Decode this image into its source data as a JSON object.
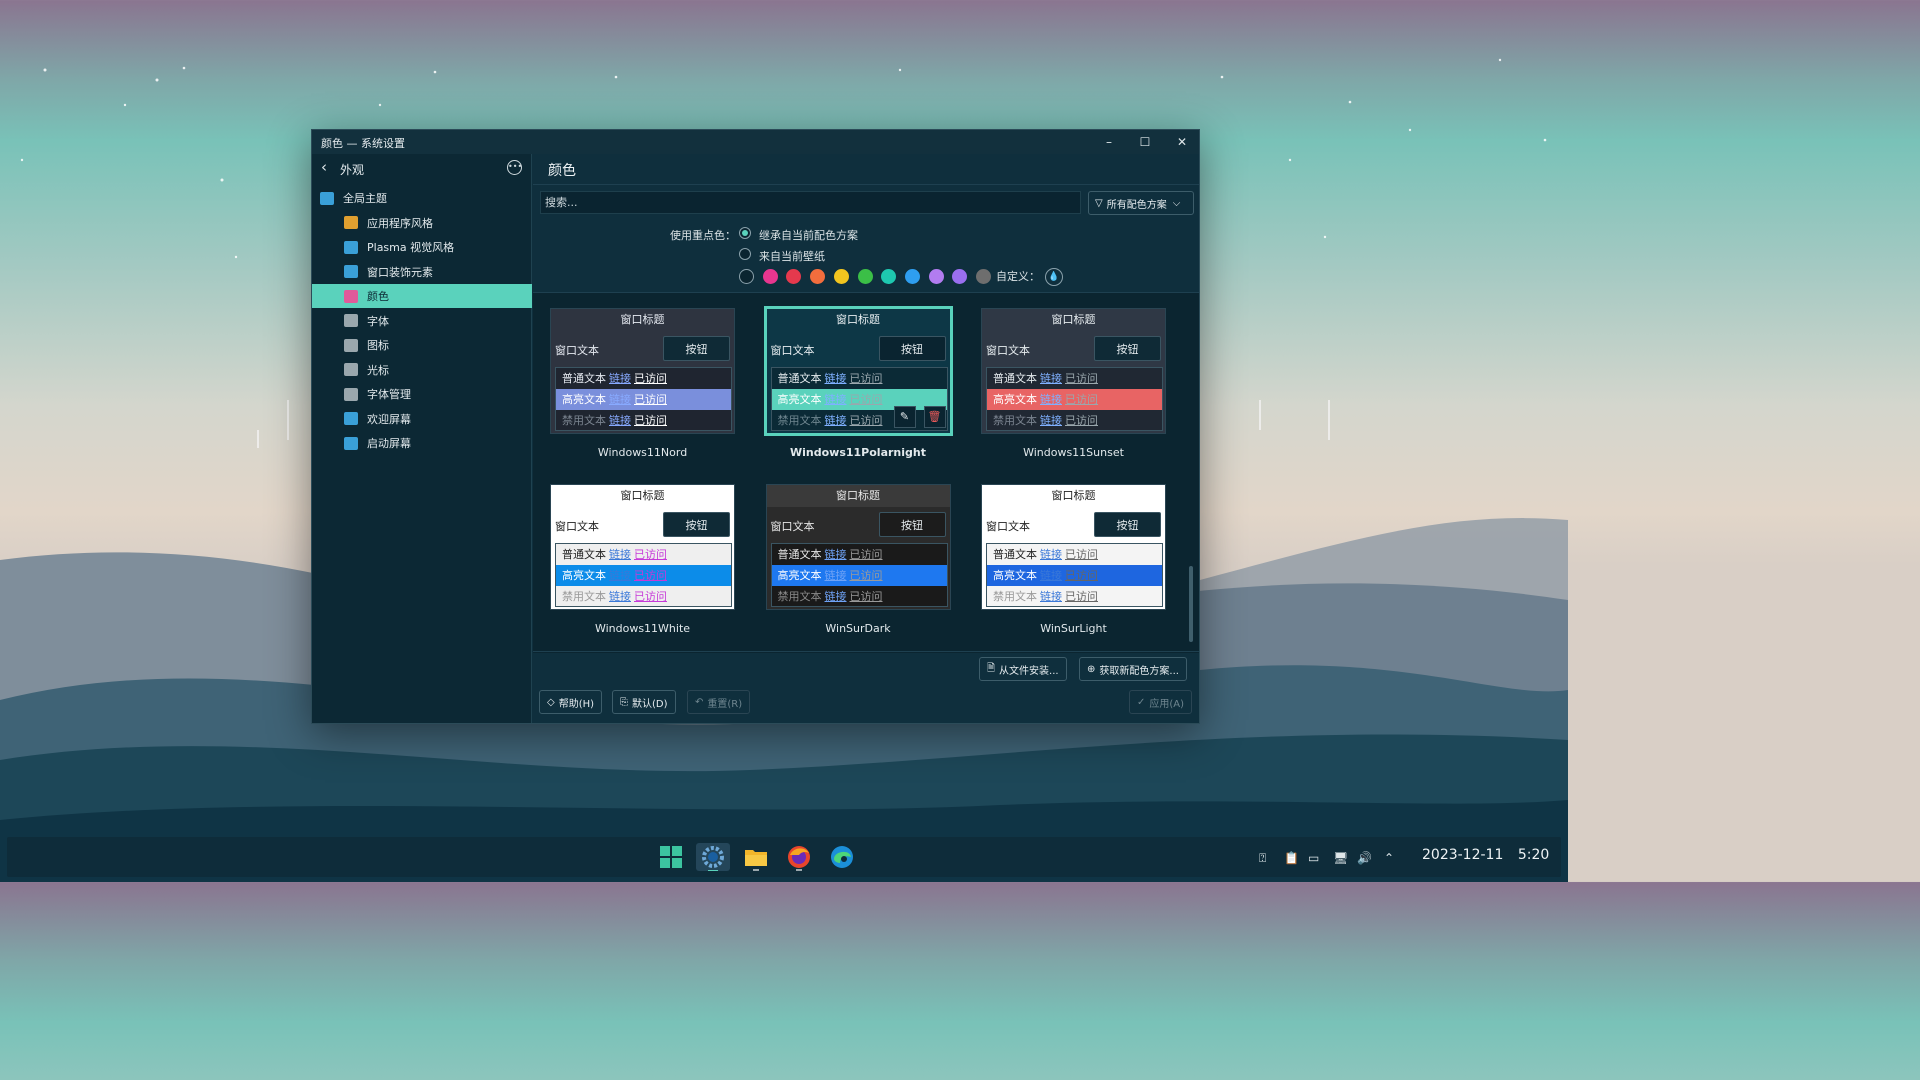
{
  "window": {
    "title": "颜色 — 系统设置",
    "minimize_label": "–",
    "maximize_label": "☐",
    "close_label": "✕"
  },
  "sidebar": {
    "back_label": "外观",
    "items": [
      {
        "label": "全局主题",
        "icon": "global-theme-icon",
        "color": "#3aa0d8"
      },
      {
        "label": "应用程序风格",
        "icon": "app-style-icon",
        "color": "#e0a030"
      },
      {
        "label": "Plasma 视觉风格",
        "icon": "plasma-style-icon",
        "color": "#3aa0d8"
      },
      {
        "label": "窗口装饰元素",
        "icon": "window-decoration-icon",
        "color": "#3aa0d8"
      },
      {
        "label": "颜色",
        "icon": "colors-icon",
        "color": "#e05a9a"
      },
      {
        "label": "字体",
        "icon": "fonts-icon",
        "color": "#9aa7ad"
      },
      {
        "label": "图标",
        "icon": "icons-icon",
        "color": "#9aa7ad"
      },
      {
        "label": "光标",
        "icon": "cursor-icon",
        "color": "#9aa7ad"
      },
      {
        "label": "字体管理",
        "icon": "font-manager-icon",
        "color": "#9aa7ad"
      },
      {
        "label": "欢迎屏幕",
        "icon": "splash-screen-icon",
        "color": "#3aa0d8"
      },
      {
        "label": "启动屏幕",
        "icon": "boot-screen-icon",
        "color": "#3aa0d8"
      }
    ],
    "active_index": 4
  },
  "content": {
    "title": "颜色",
    "search_placeholder": "搜索...",
    "filter_label": "所有配色方案",
    "accent_label": "使用重点色：",
    "radio_inherit": "继承自当前配色方案",
    "radio_wallpaper": "来自当前壁纸",
    "custom_label": "自定义：",
    "swatches": [
      "#0b2530",
      "#e8368f",
      "#e5394d",
      "#f26d3d",
      "#f2c51f",
      "#3bbf47",
      "#1ec8b0",
      "#2e9ef0",
      "#b27cf0",
      "#9a6ff0",
      "#6e6e6e"
    ]
  },
  "schemes": [
    {
      "name": "Windows11Nord",
      "title": "窗口标题",
      "window_text": "窗口文本",
      "button": "按钮",
      "normal": "普通文本",
      "highlight": "高亮文本",
      "disabled": "禁用文本",
      "link": "链接",
      "visited": "已访问"
    },
    {
      "name": "Windows11Polarnight",
      "title": "窗口标题",
      "window_text": "窗口文本",
      "button": "按钮",
      "normal": "普通文本",
      "highlight": "高亮文本",
      "disabled": "禁用文本",
      "link": "链接",
      "visited": "已访问"
    },
    {
      "name": "Windows11Sunset",
      "title": "窗口标题",
      "window_text": "窗口文本",
      "button": "按钮",
      "normal": "普通文本",
      "highlight": "高亮文本",
      "disabled": "禁用文本",
      "link": "链接",
      "visited": "已访问"
    },
    {
      "name": "Windows11White",
      "title": "窗口标题",
      "window_text": "窗口文本",
      "button": "按钮",
      "normal": "普通文本",
      "highlight": "高亮文本",
      "disabled": "禁用文本",
      "link": "链接",
      "visited": "已访问"
    },
    {
      "name": "WinSurDark",
      "title": "窗口标题",
      "window_text": "窗口文本",
      "button": "按钮",
      "normal": "普通文本",
      "highlight": "高亮文本",
      "disabled": "禁用文本",
      "link": "链接",
      "visited": "已访问"
    },
    {
      "name": "WinSurLight",
      "title": "窗口标题",
      "window_text": "窗口文本",
      "button": "按钮",
      "normal": "普通文本",
      "highlight": "高亮文本",
      "disabled": "禁用文本",
      "link": "链接",
      "visited": "已访问"
    }
  ],
  "selected_scheme_index": 1,
  "buttons": {
    "install_from_file": "从文件安装...",
    "get_new": "获取新配色方案...",
    "help": "帮助(H)",
    "defaults": "默认(D)",
    "reset": "重置(R)",
    "apply": "应用(A)"
  },
  "taskbar": {
    "date": "2023-12-11",
    "time": "5:20"
  },
  "colors": {
    "accent": "#5ad2bc",
    "window_bg": "#0f2f3d",
    "sidebar_bg": "#0c2834"
  }
}
